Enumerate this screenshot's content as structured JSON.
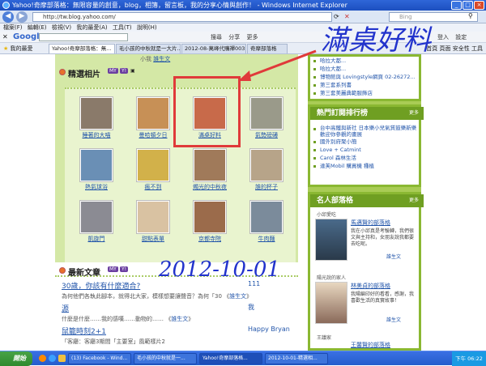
{
  "window": {
    "title": "Yahoo!奇摩部落格：無限容量的創意，blog，相簿，留言板，我的分享心情與創作！ - Windows Internet Explorer"
  },
  "address": {
    "url": "http://tw.blog.yahoo.com/",
    "search_placeholder": "Bing"
  },
  "menu": {
    "items": [
      "檔案(F)",
      "編輯(E)",
      "檢視(V)",
      "我的最愛(A)",
      "工具(T)",
      "說明(H)"
    ]
  },
  "google_bar": {
    "logo": "Google",
    "items": [
      "搜尋",
      "分享",
      "更多",
      "登入",
      "設定"
    ]
  },
  "favorites": {
    "label": "我的最愛",
    "tabs": [
      "Yahoo!奇摩部落格：無...",
      "毛小孩的中秋就是一大片...",
      "2012-08-萬峰代購禪003 - ...",
      "奇摩部落格"
    ],
    "tools": [
      "首頁",
      "頁面",
      "安全性",
      "工具"
    ]
  },
  "featured": {
    "title": "精選相片",
    "badge_my": "MY",
    "badge_y": "Y!",
    "more": "更多",
    "top_note": "小我",
    "top_link": "誰生文",
    "photos": [
      {
        "caption": "睡著的大喵",
        "color": "#8a7a6a"
      },
      {
        "caption": "曼哈頓夕日",
        "color": "#c79056"
      },
      {
        "caption": "滿桌好料",
        "color": "#c86a4a"
      },
      {
        "caption": "氣勢磅礡",
        "color": "#9a9a8a"
      },
      {
        "caption": "熱氣球浴",
        "color": "#6a8fb5"
      },
      {
        "caption": "瘋不到",
        "color": "#d2b14a"
      },
      {
        "caption": "燭光的中秋夜",
        "color": "#a07a5a"
      },
      {
        "caption": "誰的杯子",
        "color": "#b7a489"
      },
      {
        "caption": "凱旋門",
        "color": "#8b8b93"
      },
      {
        "caption": "甜點表單",
        "color": "#d9c2a2"
      },
      {
        "caption": "京都寺院",
        "color": "#9b6b4b"
      },
      {
        "caption": "牛肉麵",
        "color": "#7b8b9b"
      }
    ]
  },
  "annotation": {
    "handwritten_title": "滿桌好料",
    "date_stamp": "2012-10-01"
  },
  "latest": {
    "title": "最新文章",
    "posts": [
      {
        "title": "30歲，你該有什麼適合?",
        "author": "111",
        "excerpt": "為何他們各執此腳本，就得北大家，模樣想要讓聲音？為何「30",
        "link": "誰生文"
      },
      {
        "title": "源",
        "author": "我",
        "excerpt": "什麼是什麼……我的感嘆……動物的……",
        "link": "誰生文"
      },
      {
        "title": "鼠籠時刻2+1",
        "author": "Happy Bryan",
        "excerpt": "「客廳：客廳3期間「主要室」風範樣片2",
        "link": ""
      }
    ]
  },
  "right": {
    "top_items": [
      "哈拉大都...",
      "哈拉大都...",
      "博物館與 Lovingstyle網頁 02-26272...",
      "第三套系列書",
      "第三套美麗典範服飾店"
    ],
    "rank_title": "熱門訂閱排行榜",
    "rank_more": "更多",
    "rank_items": [
      "台中高鐵與新社 日本樂小兒氣質鼓樂新樂 歡迎你參觀的畫展",
      "國外別府聚小簡",
      "Love + Catmint",
      "Carol 森林生活",
      "達芙Mobil 購買機 種植"
    ],
    "celeb_title": "名人部落格",
    "celeb_more": "更多",
    "celeb": [
      {
        "label": "小邱愛吃",
        "name": "馬邁賢的部落格",
        "desc": "我在小邱真是考驗轉，我們很文與主持和，女朋友說我都要去吃呢。",
        "link": "誰生文"
      },
      {
        "label": "陽光說的家人",
        "name": "林美貞的部落格",
        "desc": "我陽編印好的看看，感謝，我喜歡生活的真實故事！",
        "link": "誰生文"
      },
      {
        "label": "王議家",
        "name": "王馨賢的部落格",
        "desc": "",
        "link": ""
      }
    ]
  },
  "taskbar": {
    "start": "開始",
    "items": [
      "(13) Facebook - Wind...",
      "毛小孩的中秋就是一...",
      "Yahoo!奇摩部落格...",
      "2012-10-01-精選相..."
    ],
    "clock": "下午 06:22"
  }
}
